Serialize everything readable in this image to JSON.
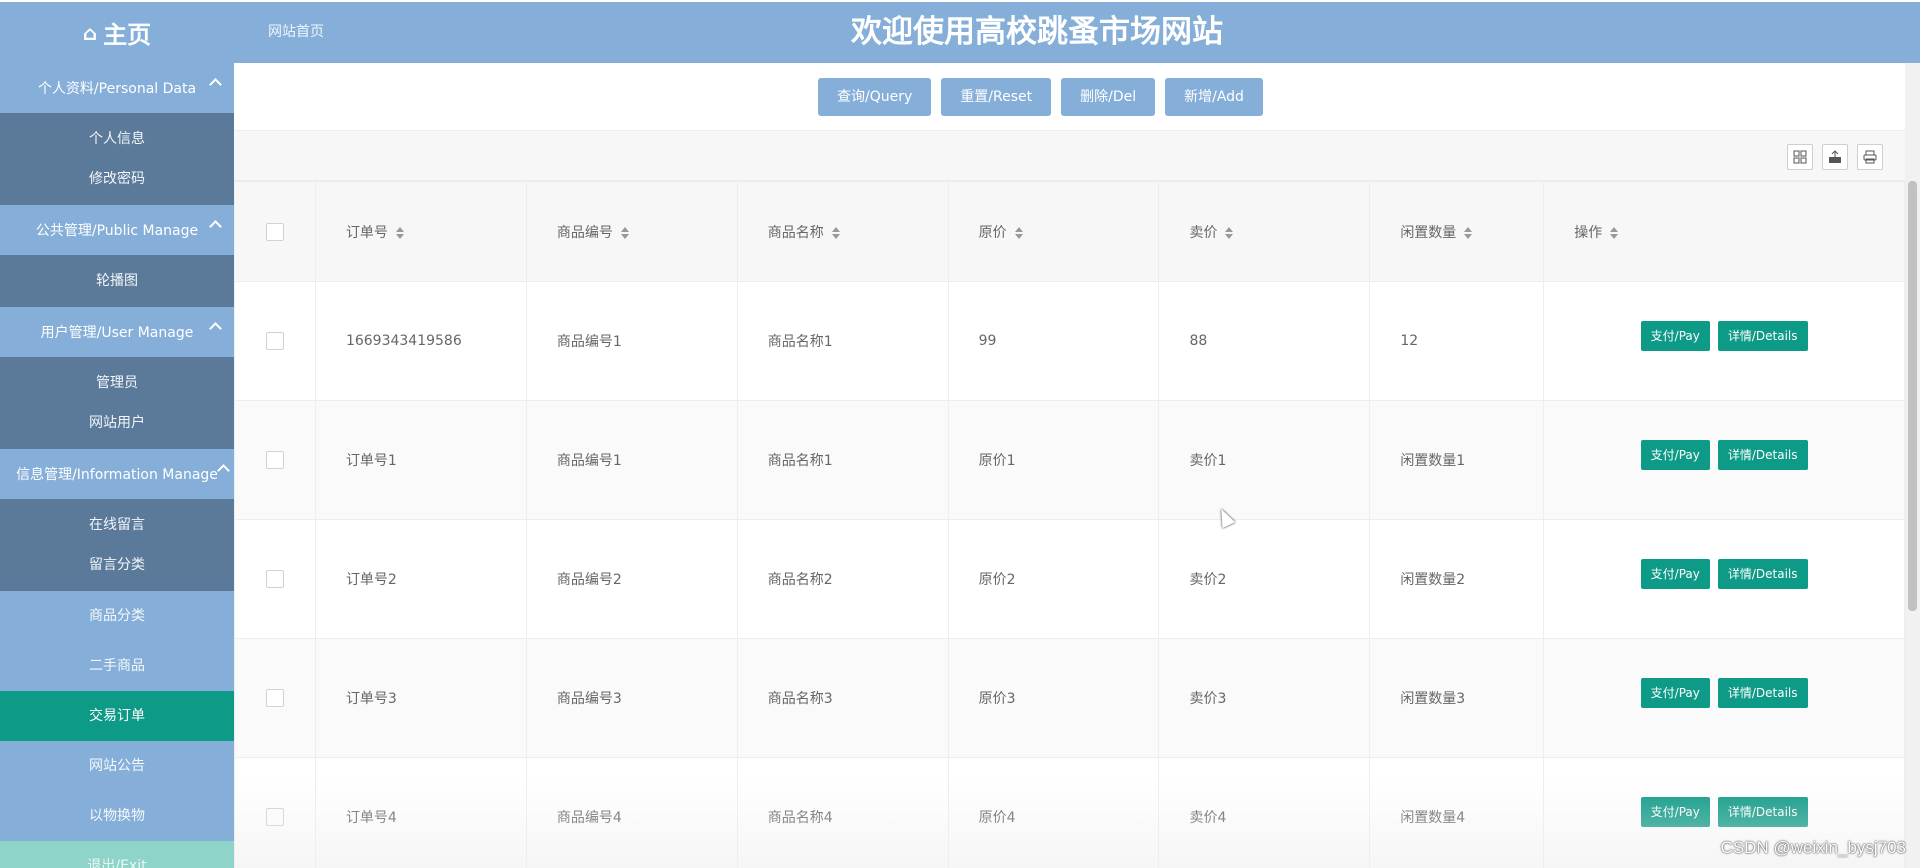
{
  "header": {
    "home_icon": "home-icon",
    "home_label": "主页",
    "breadcrumb": "网站首页",
    "site_title": "欢迎使用高校跳蚤市场网站"
  },
  "sidebar": {
    "groups": [
      {
        "title": "个人资料/Personal Data",
        "items": [
          "个人信息",
          "修改密码"
        ]
      },
      {
        "title": "公共管理/Public Manage",
        "items": [
          "轮播图"
        ]
      },
      {
        "title": "用户管理/User Manage",
        "items": [
          "管理员",
          "网站用户"
        ]
      },
      {
        "title": "信息管理/Information Manage",
        "items": [
          "在线留言",
          "留言分类"
        ]
      }
    ],
    "items": [
      "商品分类",
      "二手商品",
      "交易订单",
      "网站公告",
      "以物换物",
      "退出/Exit"
    ],
    "active_item": "交易订单"
  },
  "toolbar": {
    "query": "查询/Query",
    "reset": "重置/Reset",
    "delete": "删除/Del",
    "add": "新增/Add"
  },
  "table_tools": [
    "columns-icon",
    "export-icon",
    "print-icon"
  ],
  "table": {
    "columns": [
      "订单号",
      "商品编号",
      "商品名称",
      "原价",
      "卖价",
      "闲置数量",
      "操作"
    ],
    "rows": [
      [
        "1669343419586",
        "商品编号1",
        "商品名称1",
        "99",
        "88",
        "12"
      ],
      [
        "订单号1",
        "商品编号1",
        "商品名称1",
        "原价1",
        "卖价1",
        "闲置数量1"
      ],
      [
        "订单号2",
        "商品编号2",
        "商品名称2",
        "原价2",
        "卖价2",
        "闲置数量2"
      ],
      [
        "订单号3",
        "商品编号3",
        "商品名称3",
        "原价3",
        "卖价3",
        "闲置数量3"
      ],
      [
        "订单号4",
        "商品编号4",
        "商品名称4",
        "原价4",
        "卖价4",
        "闲置数量4"
      ]
    ],
    "pay_label": "支付/Pay",
    "details_label": "详情/Details"
  },
  "watermark": "CSDN @weixin_bysj703",
  "colors": {
    "primary": "#85afd9",
    "sidebar_sub": "#5b7a99",
    "accent": "#0d9a86",
    "exit": "#8fd4c8"
  }
}
